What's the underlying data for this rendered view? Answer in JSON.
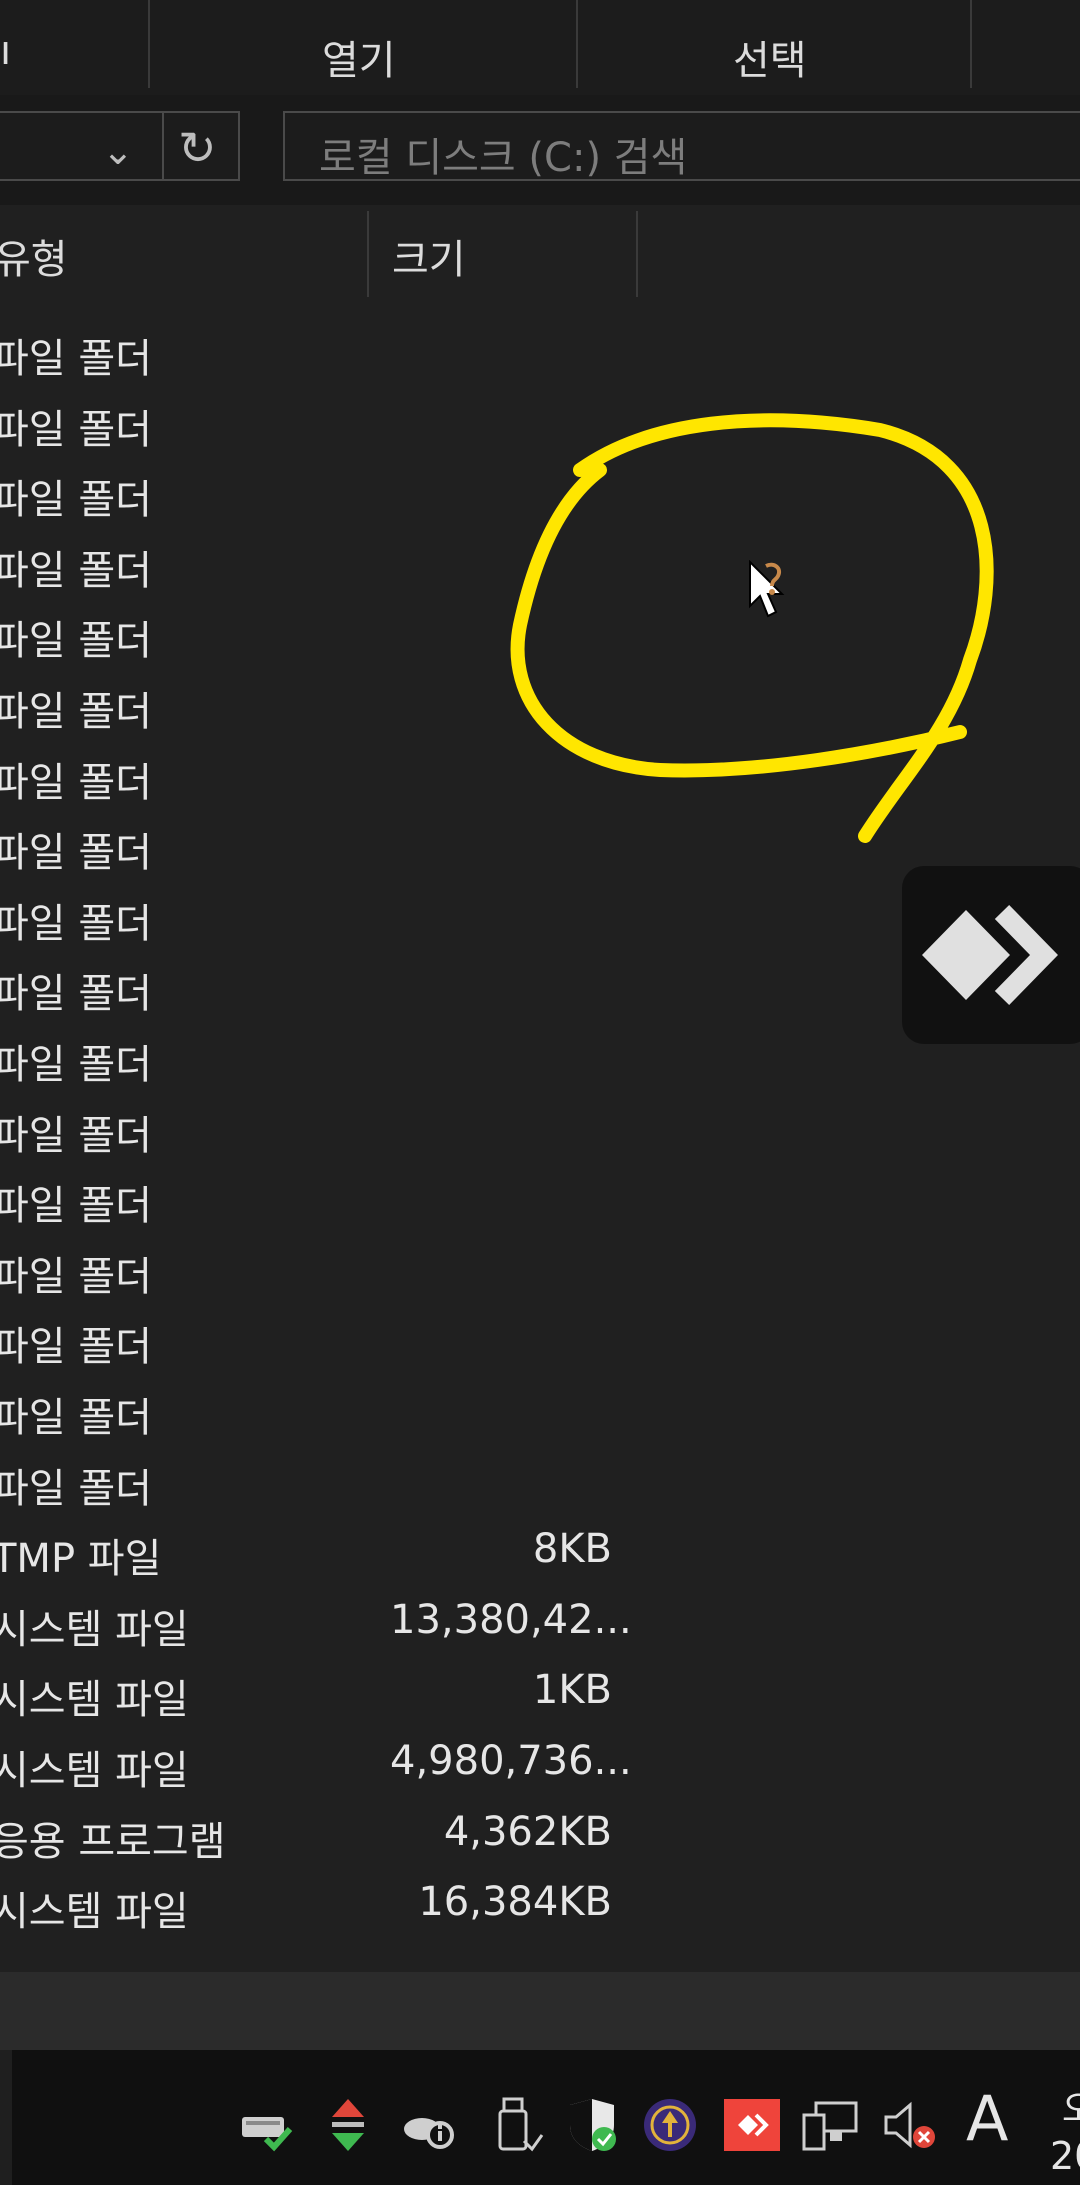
{
  "ribbon": {
    "groups": [
      {
        "label": "ı"
      },
      {
        "label": "열기"
      },
      {
        "label": "선택"
      }
    ]
  },
  "address_bar": {
    "chevron": "⌄",
    "refresh": "↻"
  },
  "search": {
    "placeholder": "로컬 디스크 (C:) 검색"
  },
  "columns": {
    "type_header": "유형",
    "size_header": "크기"
  },
  "rows": [
    {
      "type": "파일 폴더",
      "size": ""
    },
    {
      "type": "파일 폴더",
      "size": ""
    },
    {
      "type": "파일 폴더",
      "size": ""
    },
    {
      "type": "파일 폴더",
      "size": ""
    },
    {
      "type": "파일 폴더",
      "size": ""
    },
    {
      "type": "파일 폴더",
      "size": ""
    },
    {
      "type": "파일 폴더",
      "size": ""
    },
    {
      "type": "파일 폴더",
      "size": ""
    },
    {
      "type": "파일 폴더",
      "size": ""
    },
    {
      "type": "파일 폴더",
      "size": ""
    },
    {
      "type": "파일 폴더",
      "size": ""
    },
    {
      "type": "파일 폴더",
      "size": ""
    },
    {
      "type": "파일 폴더",
      "size": ""
    },
    {
      "type": "파일 폴더",
      "size": ""
    },
    {
      "type": "파일 폴더",
      "size": ""
    },
    {
      "type": "파일 폴더",
      "size": ""
    },
    {
      "type": "파일 폴더",
      "size": ""
    },
    {
      "type": "TMP 파일",
      "size": "8KB"
    },
    {
      "type": "시스템 파일",
      "size": "13,380,42..."
    },
    {
      "type": "시스템 파일",
      "size": "1KB"
    },
    {
      "type": "시스템 파일",
      "size": "4,980,736..."
    },
    {
      "type": "응용 프로그램",
      "size": "4,362KB"
    },
    {
      "type": "시스템 파일",
      "size": "16,384KB"
    }
  ],
  "taskbar": {
    "tray_icons": [
      "network-drive-check-icon",
      "up-down-arrows-icon",
      "cloud-info-icon",
      "usb-device-icon",
      "security-shield-icon",
      "update-circle-icon",
      "anydesk-tray-icon",
      "network-monitor-icon",
      "speaker-muted-icon"
    ],
    "ime_label": "A",
    "clock_partial_top": "오",
    "clock_partial_bottom": "20"
  },
  "colors": {
    "annotation": "#FFE600",
    "background": "#202020",
    "anydesk_red": "#EF443B"
  }
}
